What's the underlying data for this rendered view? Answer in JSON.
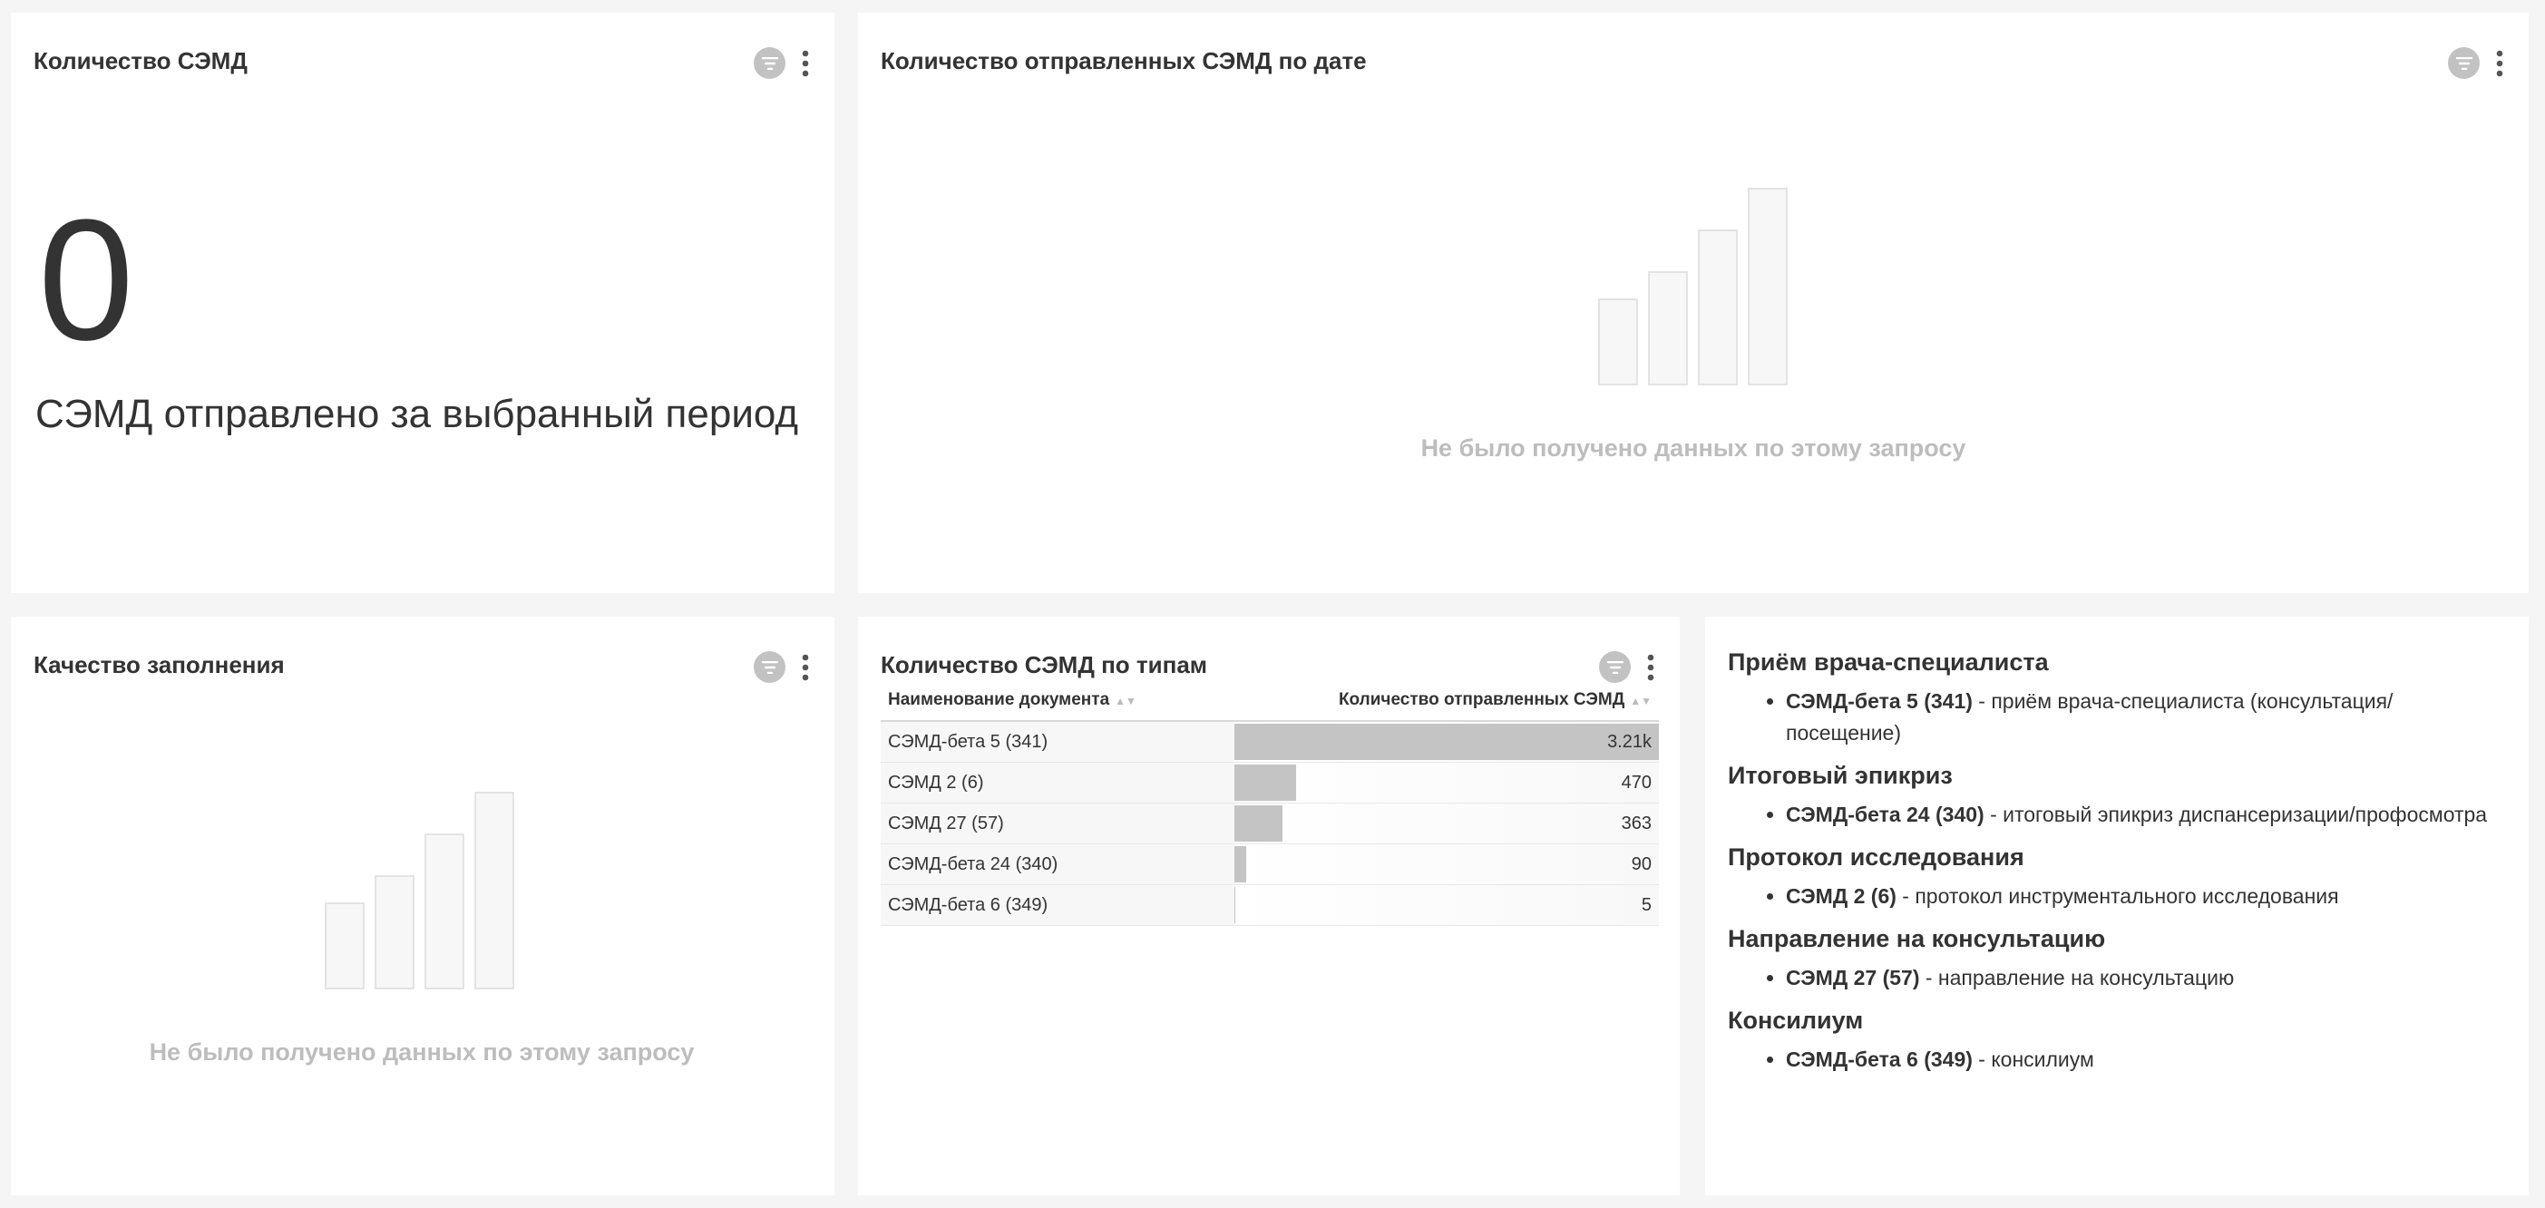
{
  "panels": {
    "count": {
      "title": "Количество СЭМД",
      "big_number": "0",
      "subtitle": "СЭМД отправлено за выбранный период"
    },
    "by_date": {
      "title": "Количество отправленных СЭМД по дате",
      "empty_text": "Не было получено данных по этому запросу"
    },
    "quality": {
      "title": "Качество заполнения",
      "empty_text": "Не было получено данных по этому запросу"
    },
    "by_type": {
      "title": "Количество СЭМД по типам",
      "columns": [
        "Наименование документа",
        "Количество отправленных СЭМД"
      ],
      "rows": [
        {
          "name": "СЭМД-бета 5 (341)",
          "value": "3.21k",
          "fraction": 1.0
        },
        {
          "name": "СЭМД 2 (6)",
          "value": "470",
          "fraction": 0.146
        },
        {
          "name": "СЭМД 27 (57)",
          "value": "363",
          "fraction": 0.113
        },
        {
          "name": "СЭМД-бета 24 (340)",
          "value": "90",
          "fraction": 0.028
        },
        {
          "name": "СЭМД-бета 6 (349)",
          "value": "5",
          "fraction": 0.0016
        }
      ]
    },
    "legend": {
      "sections": [
        {
          "heading": "Приём врача-специалиста",
          "code": "СЭМД-бета 5 (341)",
          "desc": " - приём врача-специалиста (консультация/посещение)"
        },
        {
          "heading": "Итоговый эпикриз",
          "code": "СЭМД-бета 24 (340)",
          "desc": " - итоговый эпикриз диспансеризации/профосмотра"
        },
        {
          "heading": "Протокол исследования",
          "code": "СЭМД 2 (6)",
          "desc": " - протокол инструментального исследования"
        },
        {
          "heading": "Направление на консультацию",
          "code": "СЭМД 27 (57)",
          "desc": " - направление на консультацию"
        },
        {
          "heading": "Консилиум",
          "code": "СЭМД-бета 6 (349)",
          "desc": " - консилиум"
        }
      ]
    }
  },
  "icons": {
    "filter": "filter-icon",
    "more": "more-vertical-icon"
  },
  "colors": {
    "bar": "#c4c4c4",
    "empty_text": "#bdbdbd",
    "filter_badge": "#c2c2c2"
  }
}
